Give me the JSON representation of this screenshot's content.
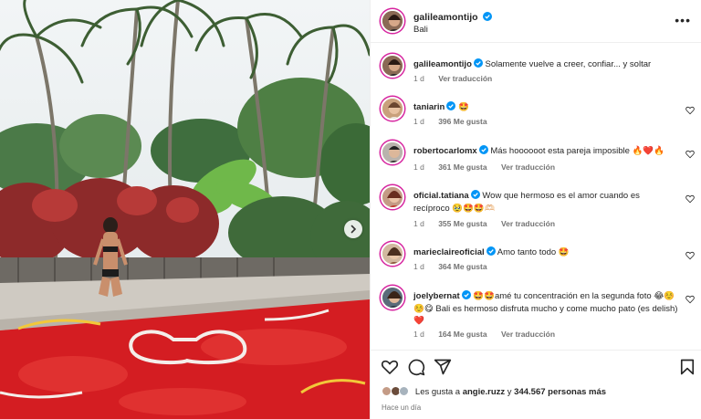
{
  "post": {
    "author": "galileamontijo",
    "location": "Bali",
    "caption": "Solamente vuelve a creer, confiar... y soltar",
    "caption_time": "1 d",
    "caption_translate": "Ver traducción"
  },
  "comments": [
    {
      "user": "taniarin",
      "text": "🤩",
      "time": "1 d",
      "likes": "396 Me gusta",
      "translate": ""
    },
    {
      "user": "robertocarlomx",
      "text": "Más hoooooot esta pareja imposible 🔥❤️🔥",
      "time": "1 d",
      "likes": "361 Me gusta",
      "translate": "Ver traducción"
    },
    {
      "user": "oficial.tatiana",
      "text": "Wow que hermoso es el amor cuando es recíproco 🥹🤩🤩🫶🏻",
      "time": "1 d",
      "likes": "355 Me gusta",
      "translate": "Ver traducción"
    },
    {
      "user": "marieclaireoficial",
      "text": "Amo tanto todo 🤩",
      "time": "1 d",
      "likes": "364 Me gusta",
      "translate": ""
    },
    {
      "user": "joelybernat",
      "text": "🤩🤩amé tu concentración en la segunda foto 😂☺️☺️😋 Bali es hermoso disfruta mucho y come mucho pato (es delish)❤️",
      "time": "1 d",
      "likes": "164 Me gusta",
      "translate": "Ver traducción"
    }
  ],
  "likes_line": {
    "prefix": "Les gusta a",
    "user": "angie.ruzz",
    "middle": "y",
    "count": "344.567 personas más"
  },
  "posted_ago": "Hace un día",
  "colors": {
    "verified": "#0095f6",
    "meta_gray": "#737373",
    "text": "#262626",
    "story_ring": "#d6249f"
  },
  "icons": {
    "like": "heart-icon",
    "comment": "comment-icon",
    "share": "share-icon",
    "save": "bookmark-icon",
    "more": "more-options-icon",
    "next": "chevron-right-icon"
  }
}
